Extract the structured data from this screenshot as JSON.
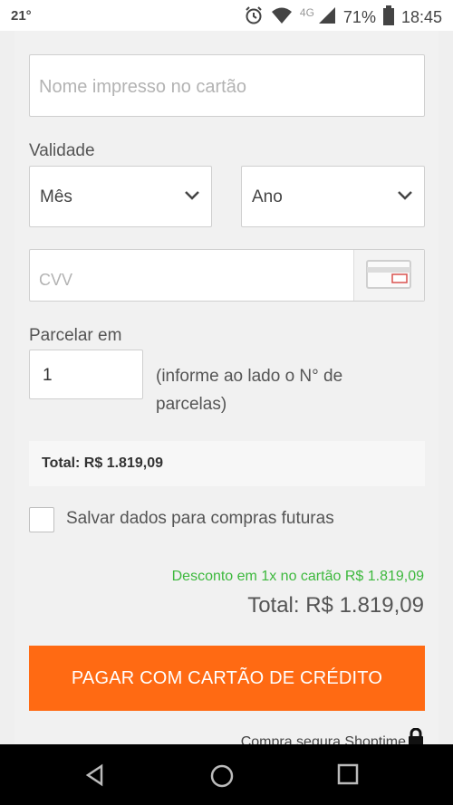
{
  "status_bar": {
    "temperature": "21°",
    "network": "4G",
    "battery": "71%",
    "time": "18:45",
    "icons": [
      "alarm-icon",
      "wifi-icon",
      "signal-icon",
      "battery-icon"
    ]
  },
  "form": {
    "name_on_card": {
      "placeholder": "Nome impresso no cartão",
      "value": ""
    },
    "validity": {
      "label": "Validade",
      "month": {
        "selected": "Mês"
      },
      "year": {
        "selected": "Ano"
      }
    },
    "cvv": {
      "placeholder": "CVV",
      "value": "",
      "addon_icon": "card-cvv-icon"
    },
    "installments": {
      "label": "Parcelar em",
      "value": "1",
      "hint": "(informe ao lado o N° de parcelas)"
    },
    "summary_total": "Total: R$ 1.819,09",
    "save_data": {
      "label": "Salvar dados para compras futuras",
      "checked": false
    },
    "discount_text": "Desconto em 1x no cartão R$ 1.819,09",
    "total_text": "Total: R$ 1.819,09",
    "pay_button": "PAGAR COM CARTÃO DE CRÉDITO",
    "secure_text": "Compra segura Shoptime"
  },
  "colors": {
    "accent": "#ff6a13",
    "discount": "#3db83d",
    "background": "#efefef"
  },
  "nav": [
    "back-icon",
    "home-icon",
    "recents-icon"
  ]
}
